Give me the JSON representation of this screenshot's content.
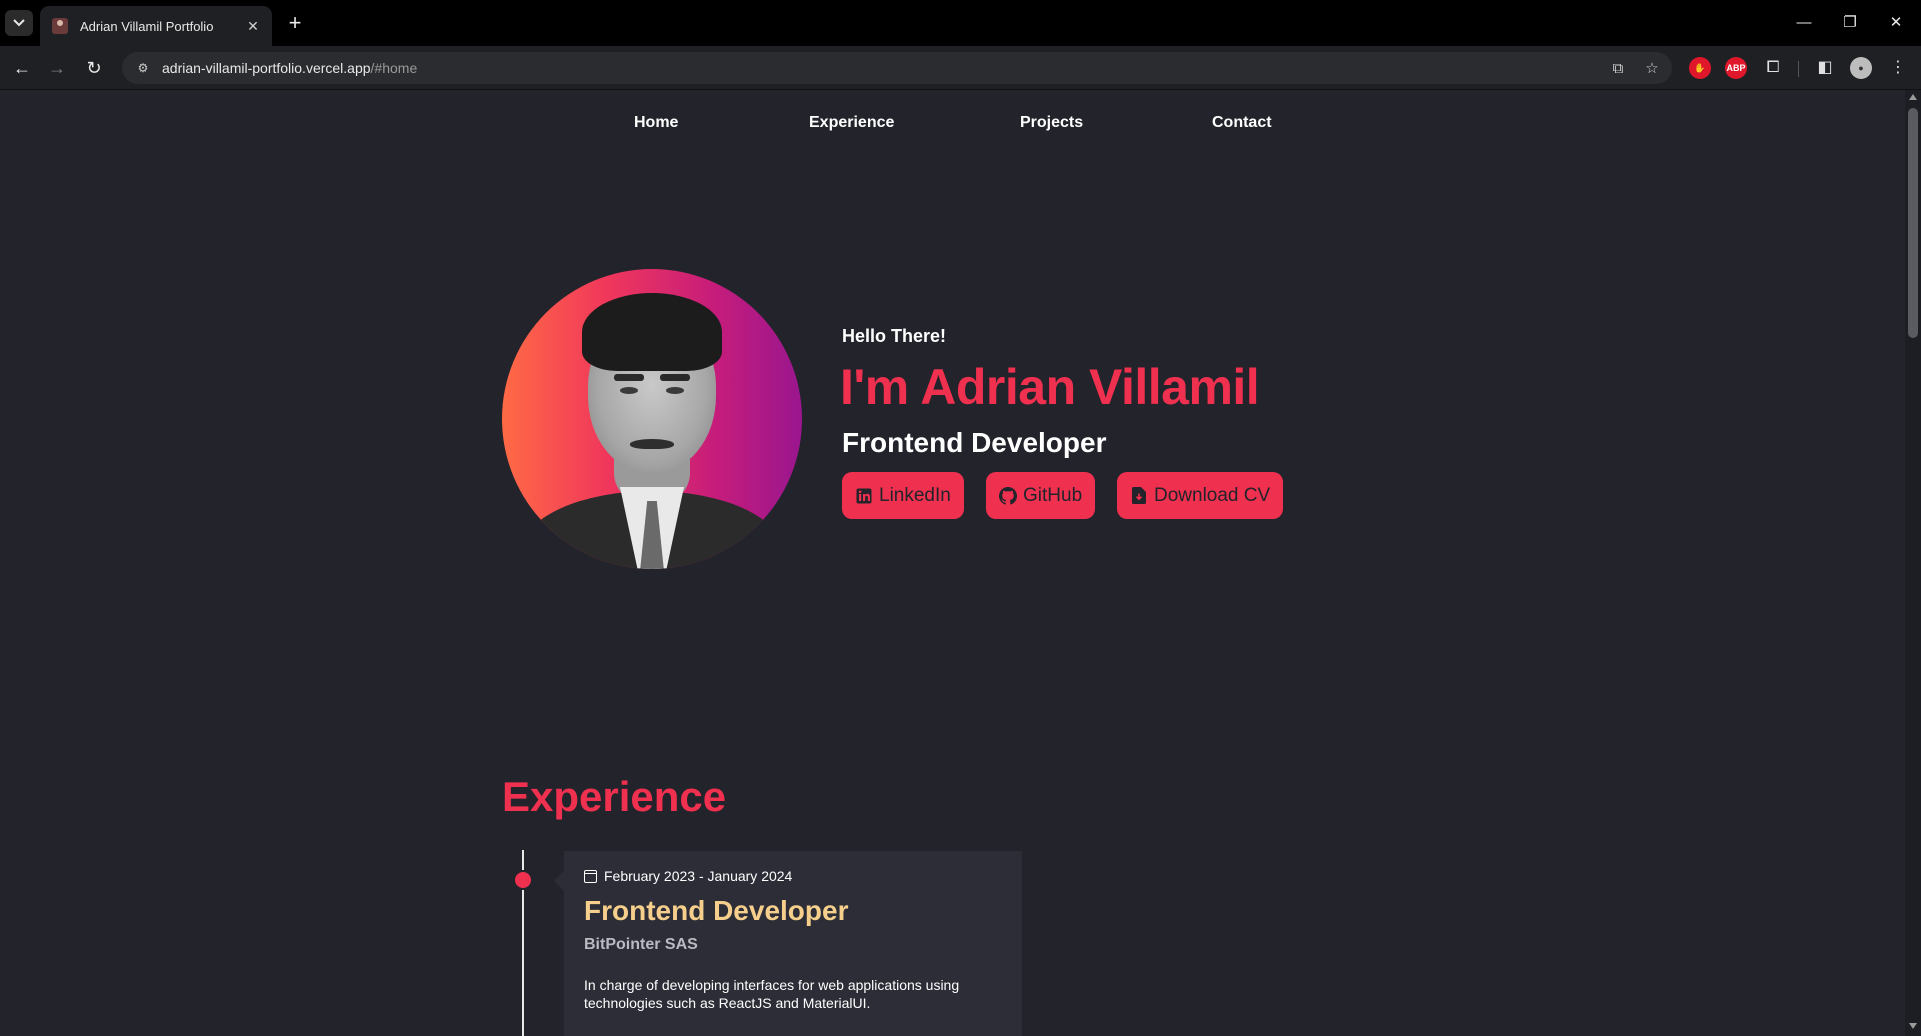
{
  "browser": {
    "tab_title": "Adrian Villamil Portfolio",
    "url_host": "adrian-villamil-portfolio.vercel.app",
    "url_path": "/#home",
    "extensions": [
      "translate-icon",
      "bookmark-star-icon",
      "hand-stop-extension-icon",
      "adblock-plus-icon",
      "extensions-puzzle-icon",
      "side-panel-icon",
      "profile-avatar",
      "menu-kebab-icon"
    ]
  },
  "nav": {
    "items": [
      {
        "label": "Home"
      },
      {
        "label": "Experience"
      },
      {
        "label": "Projects"
      },
      {
        "label": "Contact"
      }
    ]
  },
  "hero": {
    "greeting": "Hello There!",
    "name": "I'm Adrian Villamil",
    "role": "Frontend Developer",
    "buttons": [
      {
        "label": "LinkedIn",
        "icon": "linkedin-icon"
      },
      {
        "label": "GitHub",
        "icon": "github-icon"
      },
      {
        "label": "Download CV",
        "icon": "file-download-icon"
      }
    ]
  },
  "experience": {
    "title": "Experience",
    "items": [
      {
        "date": "February 2023 - January 2024",
        "position": "Frontend Developer",
        "company": "BitPointer SAS",
        "description": "In charge of developing interfaces for web applications using technologies such as ReactJS and MaterialUI."
      }
    ]
  },
  "colors": {
    "accent": "#f0304f",
    "background": "#22232b",
    "card": "#2c2d36",
    "job_title": "#f6cf8d"
  }
}
